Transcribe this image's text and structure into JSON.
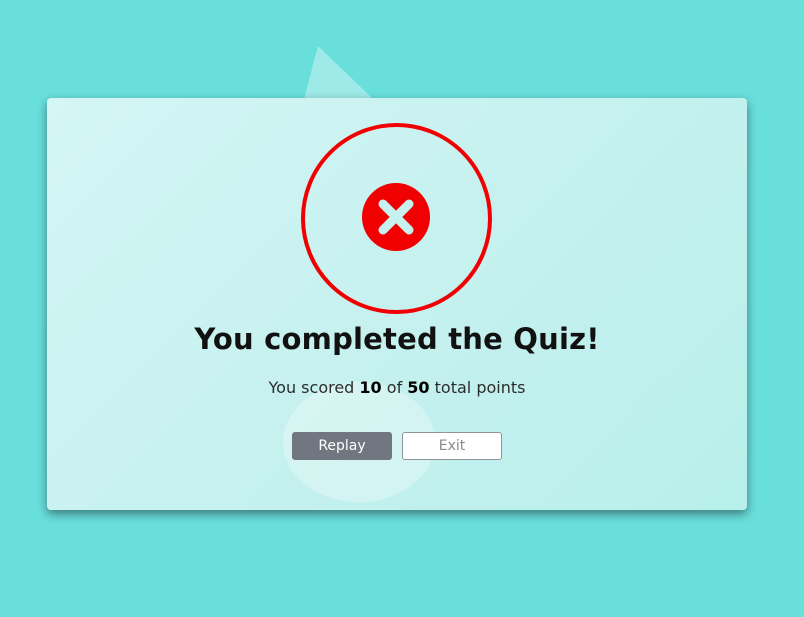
{
  "result": {
    "icon": "close-circle-icon",
    "status_color": "#f00000"
  },
  "title": "You completed the Quiz!",
  "score": {
    "prefix": "You scored",
    "value": "10",
    "middle": "of",
    "total": "50",
    "suffix": "total points"
  },
  "buttons": {
    "replay_label": "Replay",
    "exit_label": "Exit"
  },
  "colors": {
    "background": "#69dfdc",
    "replay_button": "#707781"
  }
}
